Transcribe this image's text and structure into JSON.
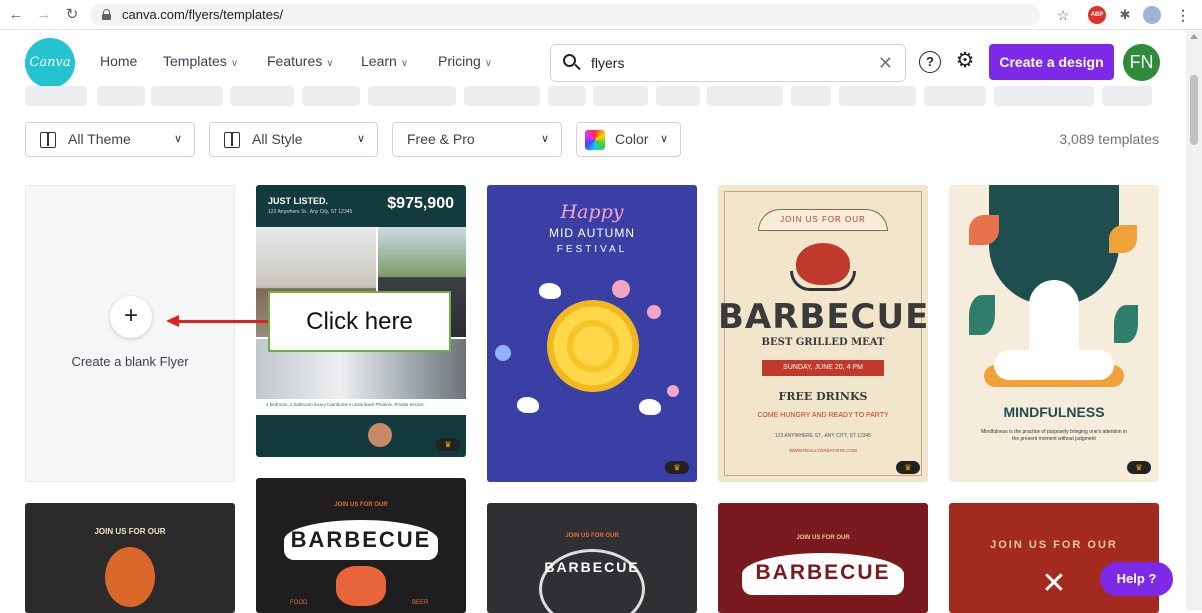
{
  "browser": {
    "url": "canva.com/flyers/templates/",
    "back_icon": "arrow-left-icon",
    "forward_icon": "arrow-right-icon",
    "reload_icon": "reload-icon",
    "star_icon": "star-icon",
    "abp_label": "ABP",
    "extensions_icon": "puzzle-icon",
    "menu_icon": "kebab-menu-icon"
  },
  "header": {
    "logo_text": "Canva",
    "nav": [
      {
        "label": "Home",
        "has_chevron": false
      },
      {
        "label": "Templates",
        "has_chevron": true
      },
      {
        "label": "Features",
        "has_chevron": true
      },
      {
        "label": "Learn",
        "has_chevron": true
      },
      {
        "label": "Pricing",
        "has_chevron": true
      }
    ],
    "search_value": "flyers",
    "help_icon_glyph": "?",
    "create_button": "Create a design",
    "avatar_initials": "FN"
  },
  "filters": {
    "theme": "All Theme",
    "style": "All Style",
    "price": "Free & Pro",
    "color": "Color",
    "count": "3,089 templates"
  },
  "blank_card": {
    "plus": "+",
    "label": "Create a blank Flyer"
  },
  "templates": {
    "real_estate": {
      "heading": "JUST LISTED.",
      "address": "123 Anywhere St., Any City, ST 12345",
      "price": "$975,900",
      "desc": "4 bedroom, 2 bathroom luxury townhome in downtown Phoenix. Private terrace."
    },
    "mid_autumn": {
      "happy": "Happy",
      "line1": "MID AUTUMN",
      "line2": "FESTIVAL"
    },
    "barbecue": {
      "ribbon": "JOIN US FOR OUR",
      "title": "BARBECUE",
      "subtitle": "BEST GRILLED MEAT",
      "date": "SUNDAY, JUNE 20, 4 PM",
      "drinks": "FREE DRINKS",
      "hungry": "COME HUNGRY AND READY TO PARTY",
      "address": "123 ANYWHERE ST., ANY CITY, ST 12345",
      "website": "WWW.REALLYGREATSITE.COM"
    },
    "mindfulness": {
      "title": "MINDFULNESS",
      "quote": "Mindfulness is the practice of purposely bringing one's attention in the present moment without judgment"
    },
    "row2": [
      {
        "banner": "JOIN US FOR OUR"
      },
      {
        "banner": "BARBECUE",
        "small": "JOIN US FOR OUR",
        "food": "FOOD",
        "beer": "BEER"
      },
      {
        "banner": "BARBECUE",
        "small": "JOIN US FOR OUR"
      },
      {
        "banner": "BARBECUE",
        "small": "JOIN US FOR OUR"
      },
      {
        "banner": "JOIN US FOR OUR"
      }
    ]
  },
  "annotation": {
    "callout": "Click here"
  },
  "help_button": "Help ?"
}
